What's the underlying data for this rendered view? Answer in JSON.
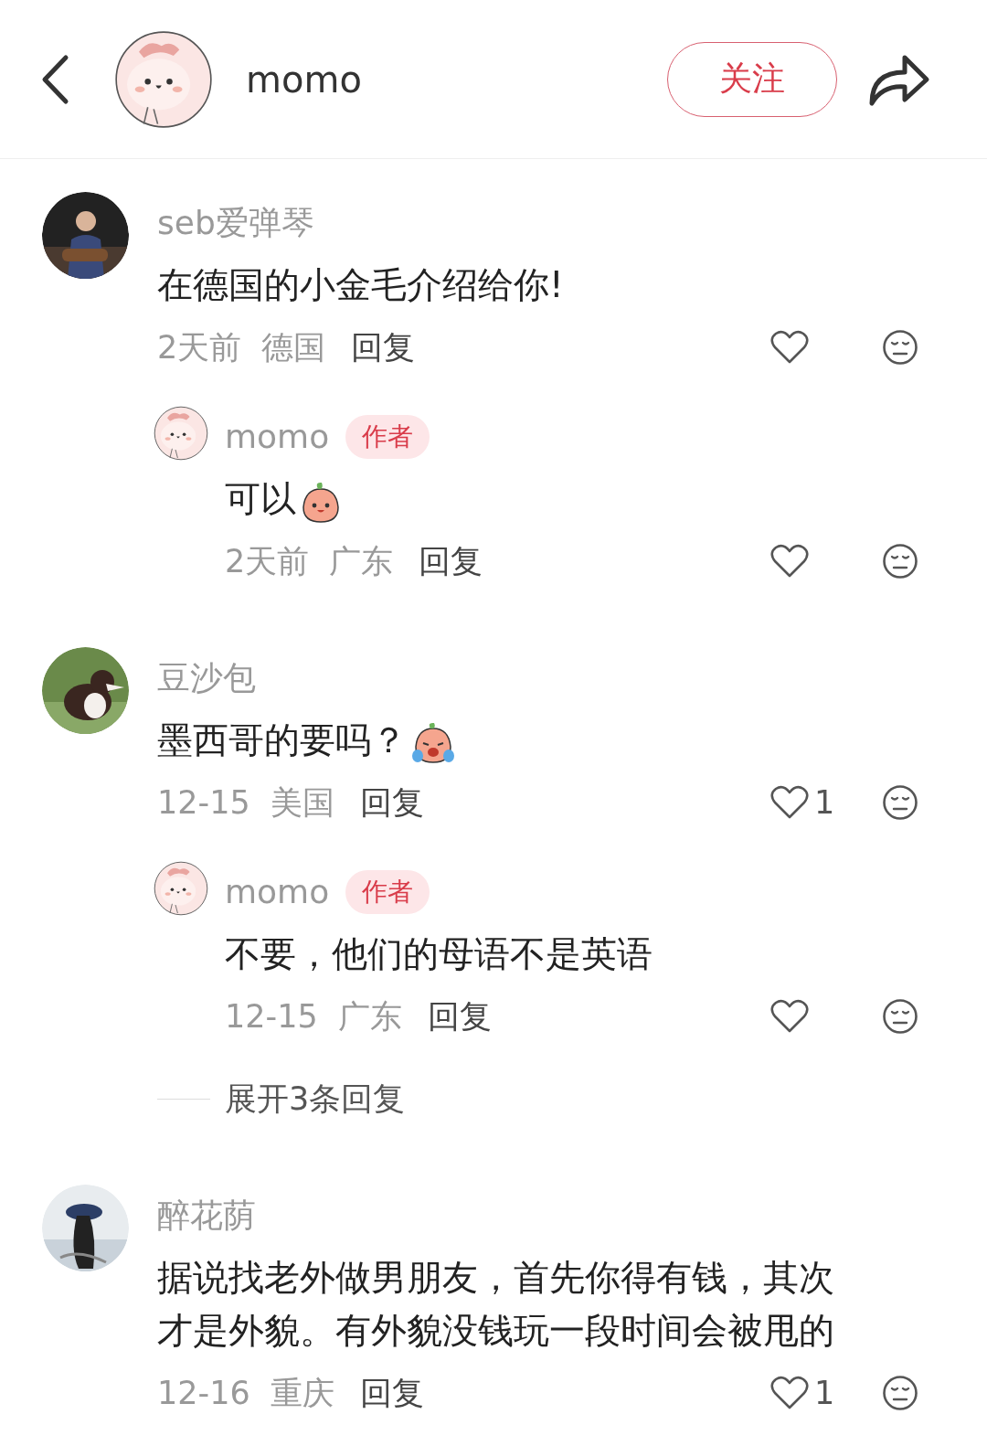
{
  "header": {
    "title": "momo",
    "follow_button": "关注"
  },
  "comments": [
    {
      "name": "seb爱弹琴",
      "text": "在德国的小金毛介绍给你!",
      "date": "2天前",
      "location": "德国",
      "reply": "回复",
      "replies": [
        {
          "name": "momo",
          "badge": "作者",
          "text": "可以",
          "sticker": {
            "kind": "smile"
          },
          "date": "2天前",
          "location": "广东",
          "reply": "回复"
        }
      ]
    },
    {
      "name": "豆沙包",
      "text": "墨西哥的要吗？",
      "sticker": {
        "kind": "cry"
      },
      "date": "12-15",
      "location": "美国",
      "reply": "回复",
      "likes": "1",
      "replies": [
        {
          "name": "momo",
          "badge": "作者",
          "text": "不要，他们的母语不是英语",
          "date": "12-15",
          "location": "广东",
          "reply": "回复"
        }
      ],
      "expand": "展开3条回复"
    },
    {
      "name": "醉花荫",
      "text": "据说找老外做男朋友，首先你得有钱，其次才是外貌。有外貌没钱玩一段时间会被甩的",
      "date": "12-16",
      "location": "重庆",
      "reply": "回复",
      "likes": "1"
    }
  ]
}
